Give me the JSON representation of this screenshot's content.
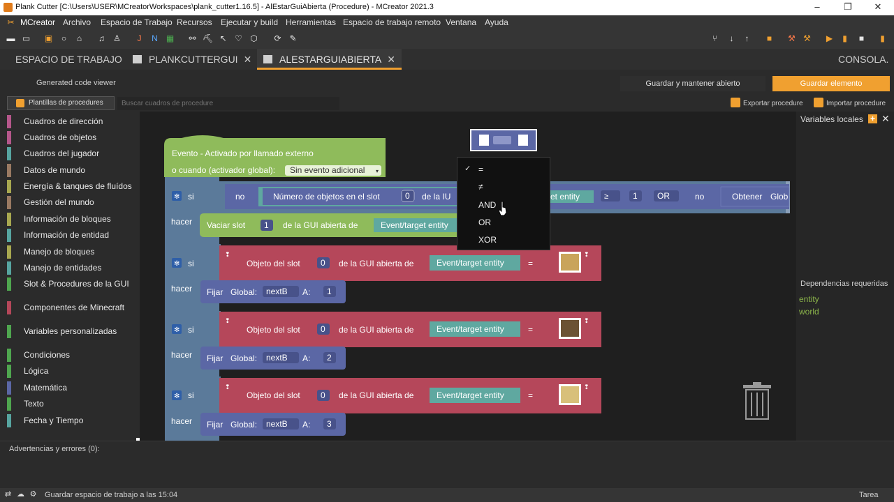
{
  "window": {
    "title": "Plank Cutter [C:\\Users\\USER\\MCreatorWorkspaces\\plank_cutter1.16.5] - AlEstarGuiAbierta (Procedure) - MCreator 2021.3",
    "minimize": "–",
    "maximize": "❐",
    "close": "✕"
  },
  "menu": [
    "MCreator",
    "Archivo",
    "Espacio de Trabajo",
    "Recursos",
    "Ejecutar y build",
    "Herramientas",
    "Espacio de trabajo remoto",
    "Ventana",
    "Ayuda"
  ],
  "tabs": {
    "workspace": "ESPACIO DE TRABAJO",
    "gui": "PLANKCUTTERGUI",
    "procedure": "ALESTARGUIABIERTA",
    "console": "CONSOLA."
  },
  "header": {
    "code_viewer": "Generated code viewer",
    "save_open": "Guardar y mantener abierto",
    "save": "Guardar elemento"
  },
  "toolbar2": {
    "templates": "Plantillas de procedures",
    "search_placeholder": "Buscar cuadros de procedure",
    "export": "Exportar procedure",
    "import": "Importar procedure"
  },
  "categories": [
    {
      "label": "Cuadros de dirección",
      "color": "#b5578b"
    },
    {
      "label": "Cuadros de objetos",
      "color": "#b5578b"
    },
    {
      "label": "Cuadros del jugador",
      "color": "#57a5a0"
    },
    {
      "label": "Datos de mundo",
      "color": "#9a7a62"
    },
    {
      "label": "Energía & tanques de fluídos",
      "color": "#a8a850"
    },
    {
      "label": "Gestión del mundo",
      "color": "#9a7a62"
    },
    {
      "label": "Información de bloques",
      "color": "#a8a850"
    },
    {
      "label": "Información de entidad",
      "color": "#57a5a0"
    },
    {
      "label": "Manejo de bloques",
      "color": "#a8a850"
    },
    {
      "label": "Manejo de entidades",
      "color": "#57a5a0"
    },
    {
      "label": "Slot & Procedures de la GUI",
      "color": "#4fa64f"
    },
    {
      "label": "Componentes de Minecraft",
      "color": "#b5475a"
    },
    {
      "label": "Variables personalizadas",
      "color": "#4fa64f"
    },
    {
      "label": "Condiciones",
      "color": "#4fa64f"
    },
    {
      "label": "Lógica",
      "color": "#4fa64f"
    },
    {
      "label": "Matemática",
      "color": "#5b67a5"
    },
    {
      "label": "Texto",
      "color": "#4fa64f"
    },
    {
      "label": "Fecha y Tiempo",
      "color": "#57a5a0"
    }
  ],
  "blocks": {
    "event_line1": "Evento - Activado por llamado externo",
    "event_line2": "o cuando (activador global):",
    "event_dropdown": "Sin evento adicional",
    "si": "si",
    "hacer": "hacer",
    "no": "no",
    "items_in_slot": "Número de objetos en el slot",
    "of_iu": "de la IU",
    "event_target_frag": "et entity",
    "gte": "≥",
    "or": "OR",
    "obtener": "Obtener",
    "globl": "Glob",
    "vaciar_slot": "Vaciar slot",
    "of_gui": "de la GUI abierta de",
    "event_target": "Event/target entity",
    "item_in_slot": "Objeto del slot",
    "eq": "=",
    "fijar": "Fijar",
    "global": "Global:",
    "nextB": "nextB",
    "a": "A:",
    "n0": "0",
    "n1": "1",
    "n2": "2",
    "n3": "3"
  },
  "dropdown": {
    "check": "✓",
    "items": [
      "=",
      "≠",
      "AND",
      "OR",
      "XOR"
    ]
  },
  "right_panel": {
    "local_vars": "Variables locales",
    "deps_title": "Dependencias requeridas",
    "deps": [
      "entity",
      "world"
    ]
  },
  "bottom": {
    "warnings": "Advertencias y errores (0):",
    "status": "Guardar espacio de trabajo a las 15:04",
    "task": "Tarea"
  },
  "colors": {
    "accent": "#f0a030",
    "event_block": "#8fbb5b",
    "control_block": "#5b7a9a",
    "item_block": "#b5475a",
    "variable_block": "#5b67a5",
    "entity_block": "#5fa8a0",
    "logic_block": "#5b67a5"
  }
}
